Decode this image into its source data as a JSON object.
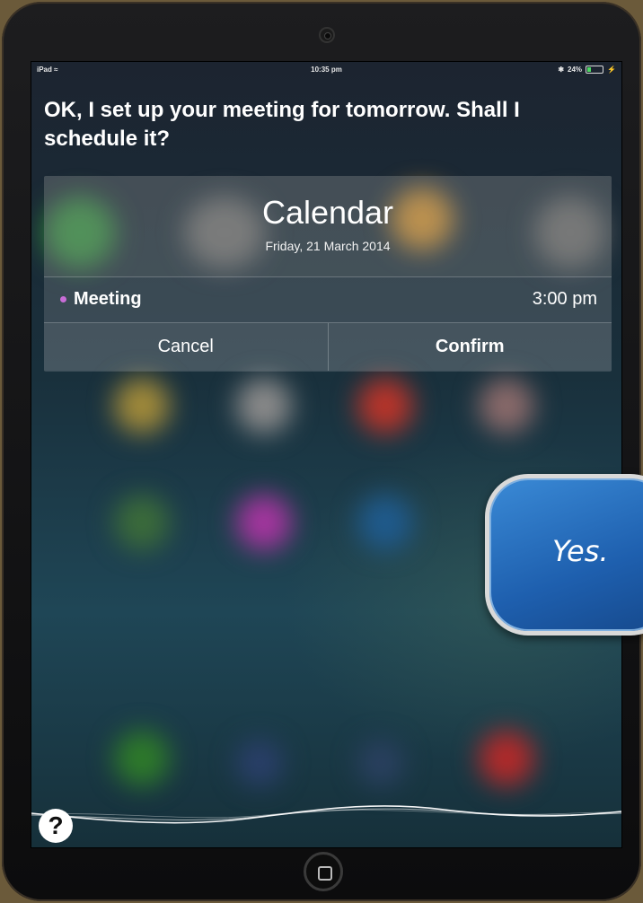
{
  "status_bar": {
    "device": "iPad",
    "time": "10:35 pm",
    "battery_percent": "24%",
    "battery_level": 0.24
  },
  "siri": {
    "prompt": "OK, I set up your meeting for tomorrow. Shall I schedule it?"
  },
  "calendar_card": {
    "title": "Calendar",
    "date": "Friday, 21 March 2014",
    "event": {
      "name": "Meeting",
      "time": "3:00 pm",
      "dot_color": "#c86dd7"
    },
    "cancel_label": "Cancel",
    "confirm_label": "Confirm"
  },
  "help_button": {
    "label": "?"
  },
  "speech_bubble": {
    "text": "Yes."
  },
  "colors": {
    "accent": "#c86dd7",
    "bubble": "#2a74c4",
    "battery_fill": "#4cd964"
  }
}
